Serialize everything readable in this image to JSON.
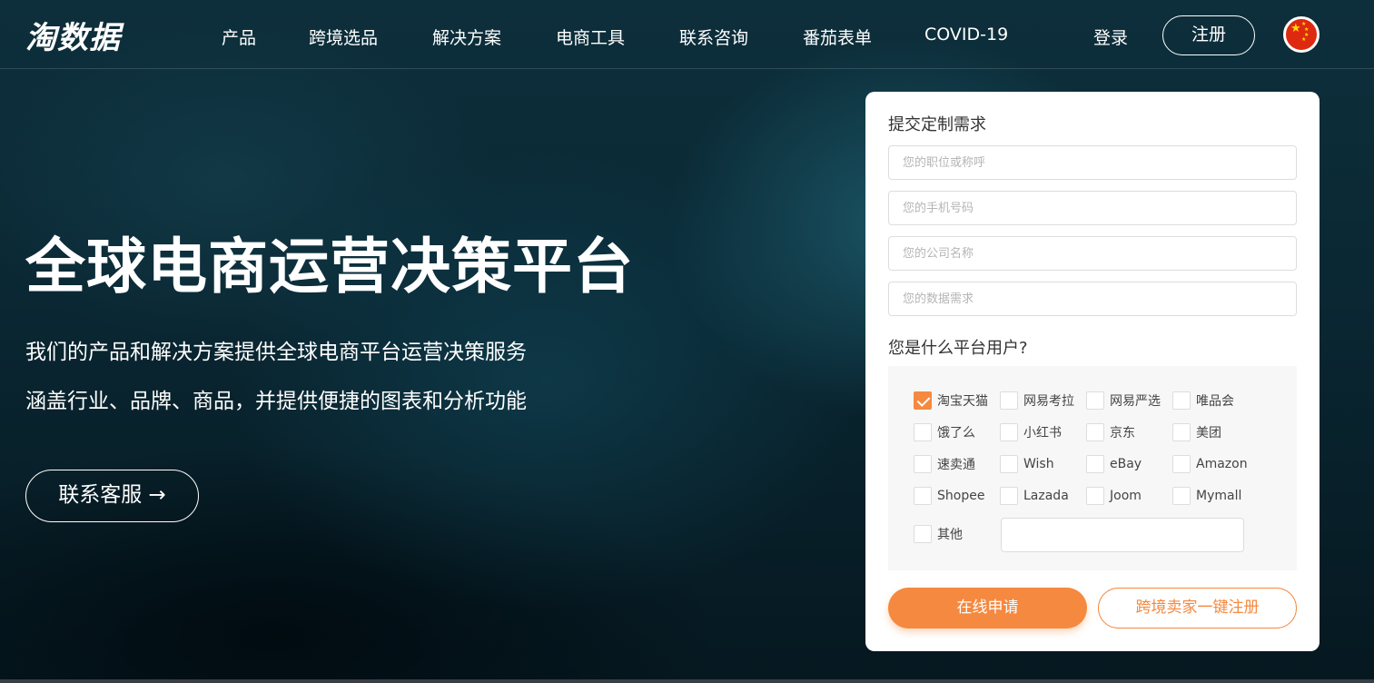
{
  "header": {
    "logo": "淘数据",
    "nav": [
      "产品",
      "跨境选品",
      "解决方案",
      "电商工具",
      "联系咨询",
      "番茄表单",
      "COVID-19"
    ],
    "login": "登录",
    "register": "注册"
  },
  "hero": {
    "title": "全球电商运营决策平台",
    "subtitle_1": "我们的产品和解决方案提供全球电商平台运营决策服务",
    "subtitle_2": "涵盖行业、品牌、商品，并提供便捷的图表和分析功能",
    "contact_button": "联系客服 →"
  },
  "form": {
    "title": "提交定制需求",
    "placeholders": {
      "position": "您的职位或称呼",
      "phone": "您的手机号码",
      "company": "您的公司名称",
      "data_need": "您的数据需求"
    },
    "question": "您是什么平台用户?",
    "options": [
      {
        "label": "淘宝天猫",
        "checked": true
      },
      {
        "label": "网易考拉",
        "checked": false
      },
      {
        "label": "网易严选",
        "checked": false
      },
      {
        "label": "唯品会",
        "checked": false
      },
      {
        "label": "饿了么",
        "checked": false
      },
      {
        "label": "小红书",
        "checked": false
      },
      {
        "label": "京东",
        "checked": false
      },
      {
        "label": "美团",
        "checked": false
      },
      {
        "label": "速卖通",
        "checked": false
      },
      {
        "label": "Wish",
        "checked": false
      },
      {
        "label": "eBay",
        "checked": false
      },
      {
        "label": "Amazon",
        "checked": false
      },
      {
        "label": "Shopee",
        "checked": false
      },
      {
        "label": "Lazada",
        "checked": false
      },
      {
        "label": "Joom",
        "checked": false
      },
      {
        "label": "Mymall",
        "checked": false
      },
      {
        "label": "其他",
        "checked": false
      }
    ],
    "other_value": "",
    "apply_button": "在线申请",
    "cross_border_button": "跨境卖家一键注册"
  },
  "colors": {
    "accent": "#f5893f",
    "flag_red": "#de2910",
    "flag_star": "#ffde00"
  },
  "icons": {
    "flag": "china-flag-icon",
    "checkmark": "check-icon"
  }
}
